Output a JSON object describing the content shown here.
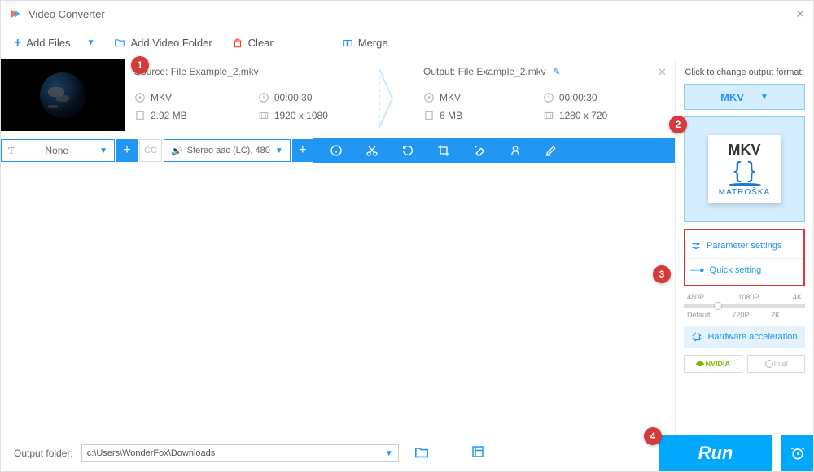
{
  "title": "Video Converter",
  "toolbar": {
    "add_files": "Add Files",
    "add_folder": "Add Video Folder",
    "clear": "Clear",
    "merge": "Merge"
  },
  "file": {
    "source_label": "Source: File Example_2.mkv",
    "output_label": "Output: File Example_2.mkv",
    "src_format": "MKV",
    "src_duration": "00:00:30",
    "src_size": "2.92 MB",
    "src_res": "1920 x 1080",
    "out_format": "MKV",
    "out_duration": "00:00:30",
    "out_size": "6 MB",
    "out_res": "1280 x 720"
  },
  "actionbar": {
    "text_track": "None",
    "audio_track": "Stereo aac (LC), 480"
  },
  "sidebar": {
    "format_hint": "Click to change output format:",
    "format": "MKV",
    "tile_text": "MKV",
    "tile_name": "MATROŠKA",
    "param_settings": "Parameter settings",
    "quick_setting": "Quick setting",
    "scale": {
      "p480": "480P",
      "p720": "720P",
      "p1080": "1080P",
      "p2k": "2K",
      "p4k": "4K",
      "default": "Default"
    },
    "hw_accel": "Hardware acceleration",
    "nvidia": "NVIDIA",
    "intel": "Intel"
  },
  "footer": {
    "folder_label": "Output folder:",
    "folder_path": "c:\\Users\\WonderFox\\Downloads",
    "run": "Run"
  },
  "annotations": {
    "a1": "1",
    "a2": "2",
    "a3": "3",
    "a4": "4"
  }
}
